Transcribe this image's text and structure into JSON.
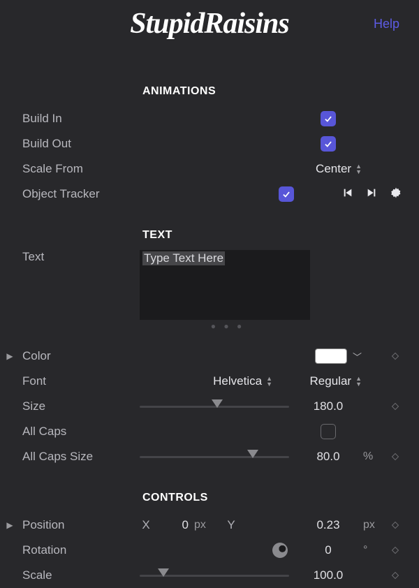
{
  "header": {
    "logo": "StupidRaisins",
    "help": "Help"
  },
  "sections": {
    "animations": {
      "title": "ANIMATIONS",
      "build_in": {
        "label": "Build In",
        "checked": true
      },
      "build_out": {
        "label": "Build Out",
        "checked": true
      },
      "scale_from": {
        "label": "Scale From",
        "value": "Center"
      },
      "object_tracker": {
        "label": "Object Tracker",
        "checked": true
      }
    },
    "text": {
      "title": "TEXT",
      "text_field": {
        "label": "Text",
        "placeholder": "Type Text Here",
        "value": ""
      },
      "color": {
        "label": "Color",
        "value": "#ffffff"
      },
      "font": {
        "label": "Font",
        "family": "Helvetica",
        "weight": "Regular"
      },
      "size": {
        "label": "Size",
        "value": "180.0"
      },
      "all_caps": {
        "label": "All Caps",
        "checked": false
      },
      "all_caps_size": {
        "label": "All Caps Size",
        "value": "80.0",
        "unit": "%"
      }
    },
    "controls": {
      "title": "CONTROLS",
      "position": {
        "label": "Position",
        "x_label": "X",
        "x": "0",
        "y_label": "Y",
        "y": "0.23",
        "unit": "px"
      },
      "rotation": {
        "label": "Rotation",
        "value": "0",
        "unit": "°"
      },
      "scale": {
        "label": "Scale",
        "value": "100.0"
      }
    }
  },
  "icons": {
    "prev": "skip-start-icon",
    "next": "skip-end-icon",
    "gear": "gear-icon",
    "keyframe": "diamond-icon",
    "chevron_down": "chevron-down-icon",
    "disclosure": "disclosure-right-icon"
  }
}
